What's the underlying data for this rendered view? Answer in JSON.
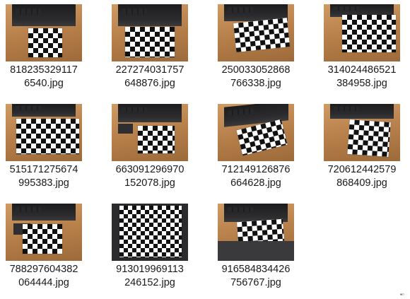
{
  "files": [
    {
      "name_line1": "818235329117",
      "name_line2": "6540.jpg"
    },
    {
      "name_line1": "227274031757",
      "name_line2": "648876.jpg"
    },
    {
      "name_line1": "250033052868",
      "name_line2": "766338.jpg"
    },
    {
      "name_line1": "314024486521",
      "name_line2": "384958.jpg"
    },
    {
      "name_line1": "515171275674",
      "name_line2": "995383.jpg"
    },
    {
      "name_line1": "663091296970",
      "name_line2": "152078.jpg"
    },
    {
      "name_line1": "712149126876",
      "name_line2": "664628.jpg"
    },
    {
      "name_line1": "720612442579",
      "name_line2": "868409.jpg"
    },
    {
      "name_line1": "788297604382",
      "name_line2": "064444.jpg"
    },
    {
      "name_line1": "913019969113",
      "name_line2": "246152.jpg"
    },
    {
      "name_line1": "916584834426",
      "name_line2": "756767.jpg"
    }
  ],
  "icons": {
    "thumbnail": "image-thumbnail-icon",
    "status": "grid-view-icon"
  },
  "colors": {
    "background": "#ffffff",
    "text": "#1a1a1a"
  }
}
